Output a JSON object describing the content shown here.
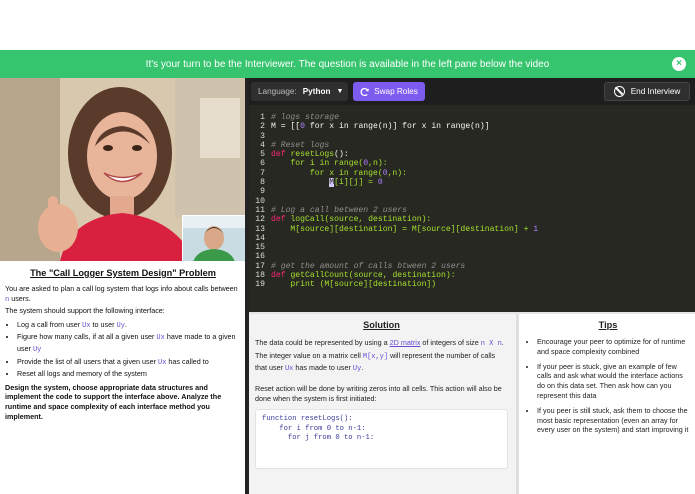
{
  "banner": {
    "text": "It's your turn to be the Interviewer. The question is available in the left pane below the video",
    "close_icon": "close-icon"
  },
  "toolbar": {
    "language_label": "Language:",
    "language_value": "Python",
    "swap_label": "Swap Roles",
    "end_label": "End Interview"
  },
  "code_lines": [
    {
      "n": "1"
    },
    {
      "n": "2"
    },
    {
      "n": "3"
    },
    {
      "n": "4"
    },
    {
      "n": "5"
    },
    {
      "n": "6"
    },
    {
      "n": "7"
    },
    {
      "n": "8"
    },
    {
      "n": "9"
    },
    {
      "n": "10"
    },
    {
      "n": "11"
    },
    {
      "n": "12"
    },
    {
      "n": "13"
    },
    {
      "n": "14"
    },
    {
      "n": "15"
    },
    {
      "n": "16"
    },
    {
      "n": "17"
    },
    {
      "n": "18"
    },
    {
      "n": "19"
    }
  ],
  "code": {
    "l1": "# logs storage",
    "l2a": "M = [[",
    "l2b": "0",
    "l2c": " for x in range(n)] ",
    "l2d": "for x in range(n)]",
    "l4": "# Reset logs",
    "l5a": "def ",
    "l5b": "resetLogs",
    "l5c": "():",
    "l6a": "    for i in range(",
    "l6b": "0",
    "l6c": ",n):",
    "l7a": "        for x in range(",
    "l7b": "0",
    "l7c": ",n):",
    "l8a": "            ",
    "l8b": "M",
    "l8c": "[i][j] = ",
    "l8d": "0",
    "l10": "# Log a call between 2 users",
    "l11a": "def ",
    "l11b": "logCall",
    "l11c": "(source, destination):",
    "l12a": "    M[source][destination] = M[source][destination] + ",
    "l12b": "1",
    "l15": "# get the amount of calls btween 2 users",
    "l16a": "def ",
    "l16b": "getCallCount",
    "l16c": "(source, destination):",
    "l17a": "    print (M[source][destination])"
  },
  "problem": {
    "title": "The \"Call Logger System Design\" Problem",
    "intro_a": "You are asked to plan a call log system that logs info about calls between ",
    "intro_n": "n",
    "intro_b": " users.",
    "intro2": "The system should support the following interface:",
    "items": [
      {
        "a": "Log a call from user ",
        "c1": "Ux",
        "b": " to user ",
        "c2": "Uy",
        "d": "."
      },
      {
        "a": "Figure how many calls, if at all a given user ",
        "c1": "Ux",
        "b": " have made to a given user ",
        "c2": "Uy",
        "d": ""
      },
      {
        "a": "Provide the list of all users that a given user ",
        "c1": "Ux",
        "b": " has called to",
        "c2": "",
        "d": ""
      },
      {
        "a": "Reset all logs and memory of the system",
        "c1": "",
        "b": "",
        "c2": "",
        "d": ""
      }
    ],
    "bold": "Design the system, choose appropriate data structures and implement the code to support the interface above. Analyze the runtime and space complexity of each interface method you implement."
  },
  "solution": {
    "title": "Solution",
    "p1a": "The data could be represented by using a ",
    "p1link": "2D matrix",
    "p1b": " of integers of size ",
    "p1c": "n X n",
    "p1d": ".",
    "p2a": "The integer value on a matrix cell ",
    "p2c": "M[x,y]",
    "p2b": " will represent the number of calls that user ",
    "p2u1": "Ux",
    "p2d": " has made to user ",
    "p2u2": "Uy",
    "p2e": ".",
    "p3": "Reset action will be done by writing zeros into all cells. This action will also be done when the system is first initiated:",
    "code1": "function resetLogs():",
    "code2": "    for i from 0 to n-1:",
    "code3": "      for j from 0 to n-1:"
  },
  "tips": {
    "title": "Tips",
    "items": [
      "Encourage your peer to optimize for of runtime and space complexity combined",
      "If your peer is stuck, give an example of few calls and ask what would the interface actions do on this data set. Then ask how can you represent this data",
      "If you peer is still stuck, ask them to choose the most basic representation (even an array for every user on the system) and start improving it"
    ]
  },
  "colors": {
    "banner": "#36c46f",
    "accent": "#7e5bef",
    "editor_bg": "#272822"
  }
}
